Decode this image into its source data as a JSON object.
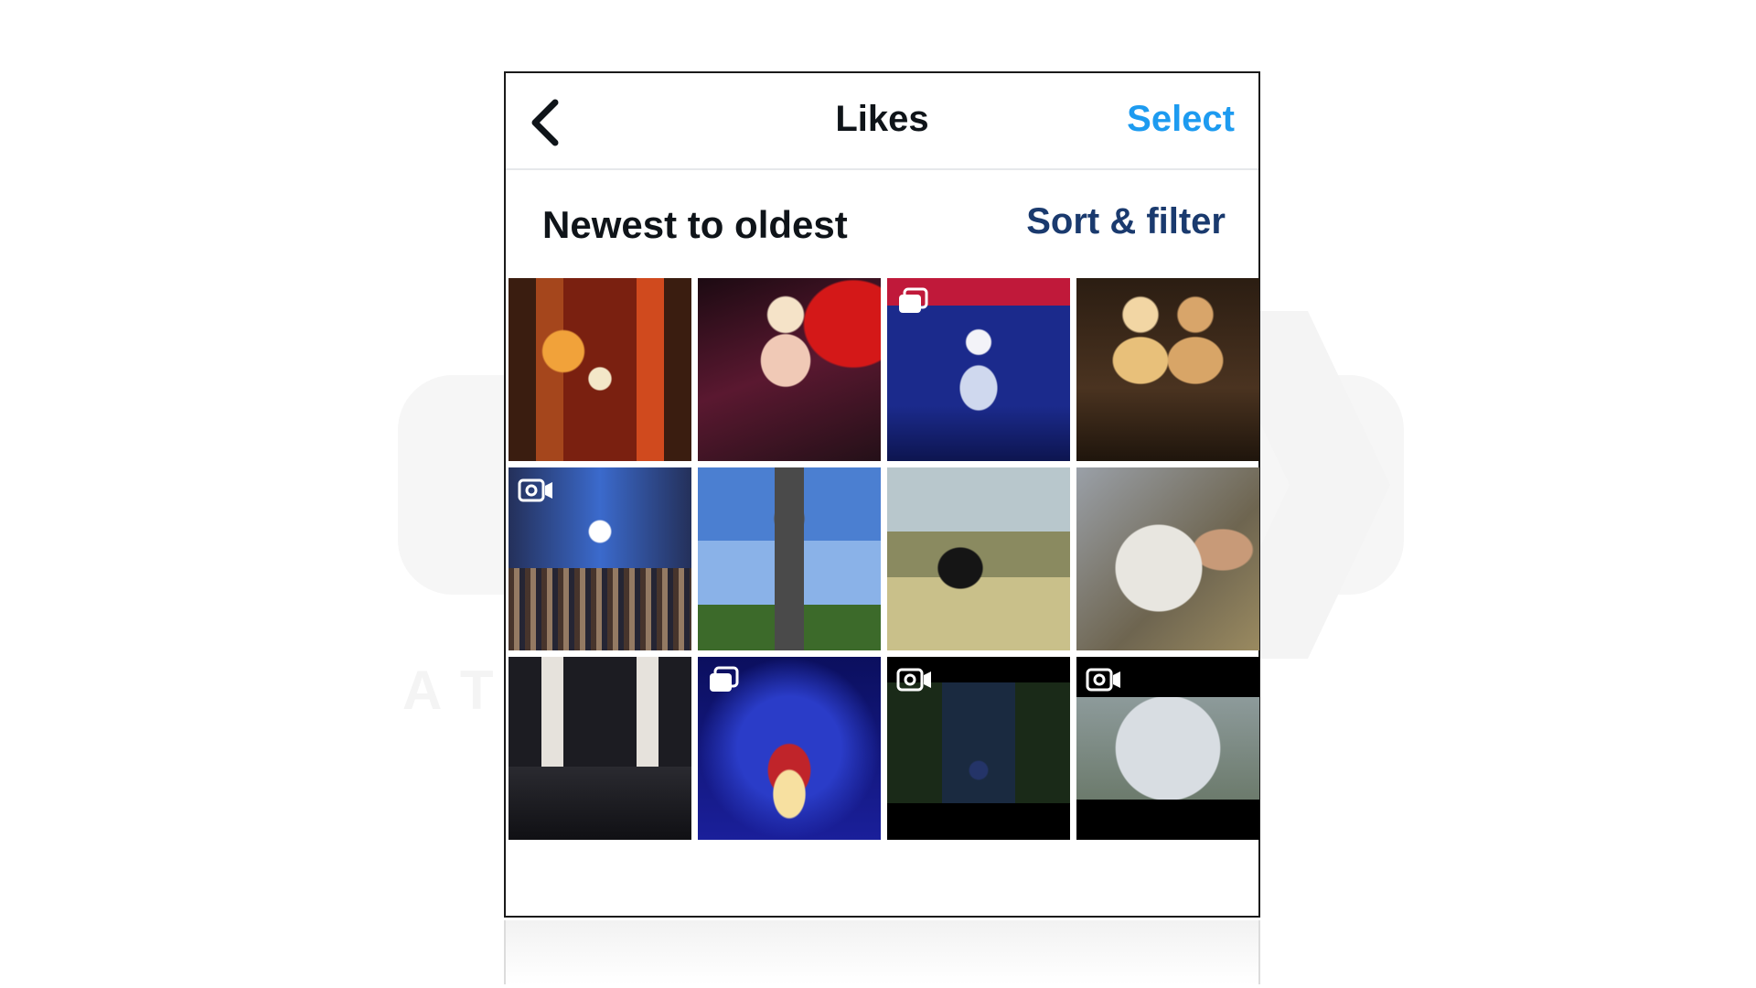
{
  "nav": {
    "title": "Likes",
    "select_label": "Select"
  },
  "sort": {
    "label": "Newest to oldest",
    "filter_label": "Sort & filter"
  },
  "watermark": {
    "text": "AT"
  },
  "media_grid": [
    {
      "id": 1,
      "badge": null
    },
    {
      "id": 2,
      "badge": null
    },
    {
      "id": 3,
      "badge": "multiple-images-icon"
    },
    {
      "id": 4,
      "badge": null
    },
    {
      "id": 5,
      "badge": "video-icon"
    },
    {
      "id": 6,
      "badge": null
    },
    {
      "id": 7,
      "badge": null
    },
    {
      "id": 8,
      "badge": null
    },
    {
      "id": 9,
      "badge": null
    },
    {
      "id": 10,
      "badge": "multiple-images-icon"
    },
    {
      "id": 11,
      "badge": "video-icon"
    },
    {
      "id": 12,
      "badge": "video-icon"
    }
  ],
  "colors": {
    "accent": "#1d9bf0",
    "sort_filter": "#1a3a6e",
    "text": "#0f1419"
  }
}
